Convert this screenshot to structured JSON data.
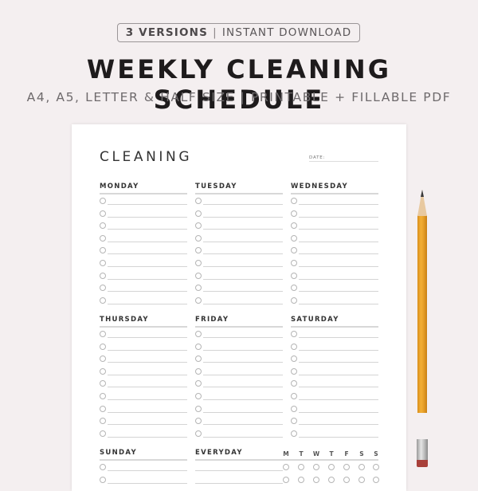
{
  "header": {
    "badge_versions": "3 VERSIONS",
    "badge_separator": "|",
    "badge_download": "INSTANT DOWNLOAD",
    "title": "WEEKLY CLEANING SCHEDULE",
    "subtitle": "A4, A5, LETTER & HALF SIZE | PRINTABLE + FILLABLE PDF"
  },
  "sheet": {
    "heading": "CLEANING",
    "date_label": "DATE:",
    "days_row1": [
      "MONDAY",
      "TUESDAY",
      "WEDNESDAY"
    ],
    "days_row2": [
      "THURSDAY",
      "FRIDAY",
      "SATURDAY"
    ],
    "days_row3": [
      "SUNDAY",
      "EVERYDAY"
    ],
    "weekday_initials": [
      "M",
      "T",
      "W",
      "T",
      "F",
      "S",
      "S"
    ],
    "tasks_per_day": 9
  },
  "colors": {
    "background": "#f4eff0",
    "paper": "#ffffff",
    "title": "#1e1b1c",
    "pencil": "#f2ae35",
    "eraser": "#a8403a"
  }
}
